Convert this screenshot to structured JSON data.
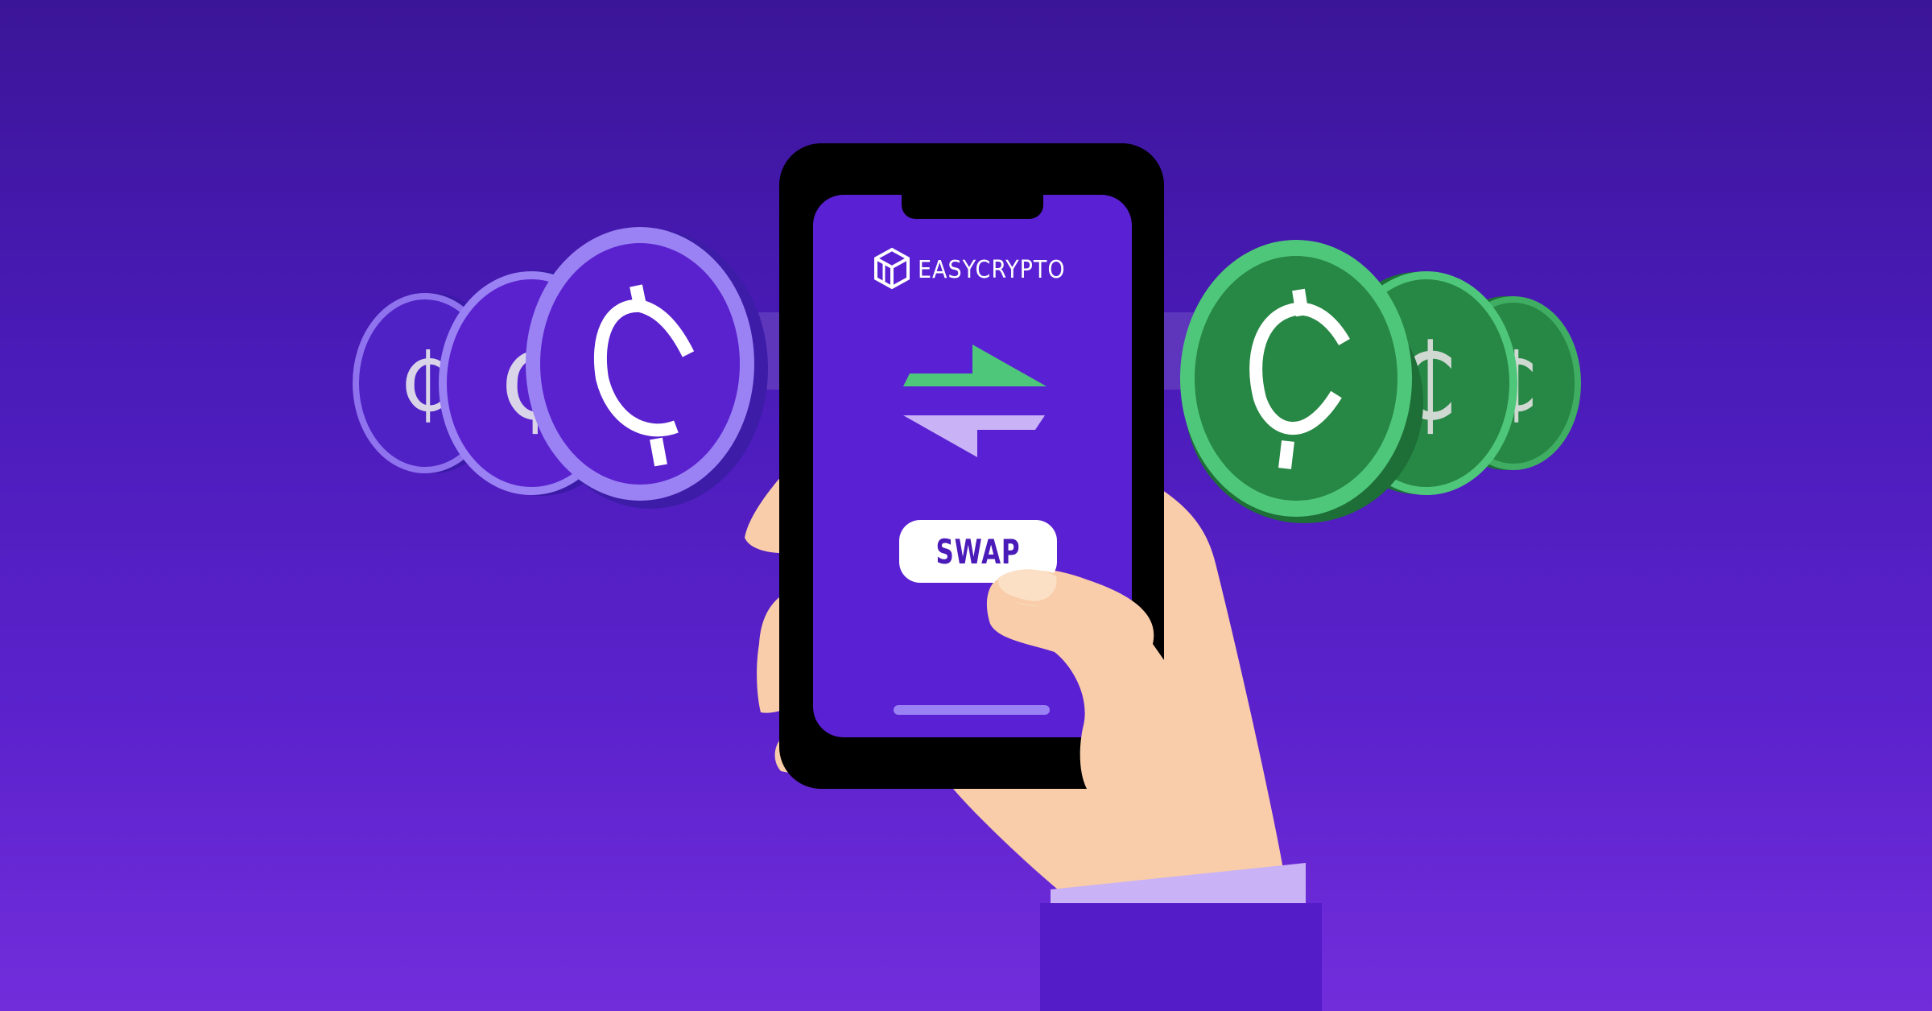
{
  "brand": {
    "name": "EASYCRYPTO",
    "logo_icon": "easycrypto-cube-logo"
  },
  "swap": {
    "label": "SWAP"
  },
  "icons": {
    "swap_arrows": "swap-arrows-icon",
    "coin_left": "celo-dollar-coin",
    "coin_right": "celo-dollar-coin"
  },
  "colors": {
    "background_top": "#3b1598",
    "background_bottom": "#722ddb",
    "screen": "#5a20d3",
    "arrow_green": "#4fc77a",
    "arrow_lavender": "#c9b2f6",
    "coin_purple": "#5a22cf",
    "coin_purple_rim": "#9a82f4",
    "coin_green": "#278744",
    "coin_green_rim": "#4fc77a",
    "skin": "#f9cda9",
    "sleeve": "#541bc9",
    "cuff": "#c9b2f6"
  }
}
